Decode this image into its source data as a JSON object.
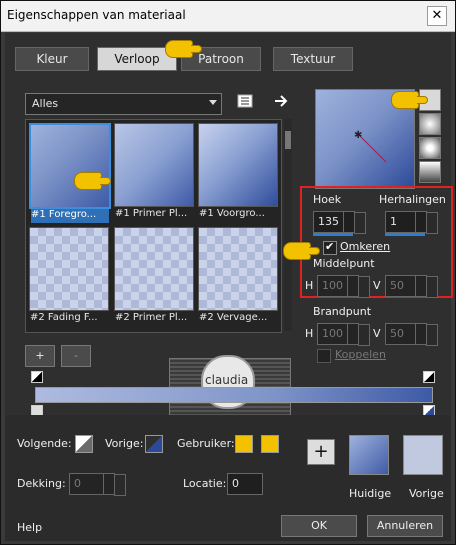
{
  "window": {
    "title": "Eigenschappen van materiaal",
    "close_glyph": "✕"
  },
  "tabs": [
    {
      "label": "Kleur",
      "active": false
    },
    {
      "label": "Verloop",
      "active": true
    },
    {
      "label": "Patroon",
      "active": false
    },
    {
      "label": "Textuur",
      "active": false
    }
  ],
  "category_select": {
    "value": "Alles"
  },
  "swatches": [
    {
      "label": "#1 Foregro...",
      "style": "g1",
      "selected": true
    },
    {
      "label": "#1 Primer Pl...",
      "style": "g2",
      "selected": false
    },
    {
      "label": "#1 Voorgro...",
      "style": "g3",
      "selected": false
    },
    {
      "label": "#2 Fading F...",
      "style": "chk",
      "selected": false
    },
    {
      "label": "#2 Primer Pl...",
      "style": "chk",
      "selected": false
    },
    {
      "label": "#2 Vervage...",
      "style": "chk",
      "selected": false
    }
  ],
  "gradient_controls": {
    "hoek_label": "Hoek",
    "hoek_value": "135",
    "herhalingen_label": "Herhalingen",
    "herhalingen_value": "1",
    "omkeren_label": "Omkeren",
    "omkeren_checked": true
  },
  "middelpunt": {
    "label": "Middelpunt",
    "h_label": "H",
    "h_value": "100",
    "v_label": "V",
    "v_value": "50"
  },
  "brandpunt": {
    "label": "Brandpunt",
    "h_label": "H",
    "h_value": "100",
    "v_label": "V",
    "v_value": "50",
    "koppelen_label": "Koppelen"
  },
  "stop_controls": {
    "add_label": "+",
    "remove_label": "-"
  },
  "footer": {
    "volgende_label": "Volgende:",
    "vorige_label": "Vorige:",
    "gebruiker_label": "Gebruiker:",
    "dekking_label": "Dekking:",
    "dekking_value": "0",
    "locatie_label": "Locatie:",
    "locatie_value": "0",
    "plus_label": "+",
    "huidige_label": "Huidige",
    "vorige_swatch_label": "Vorige",
    "help_label": "Help",
    "ok_label": "OK",
    "annuleren_label": "Annuleren"
  },
  "watermark": {
    "text": "claudia"
  },
  "colors": {
    "accent_blue": "#2e6fb5",
    "highlight_red": "#dd2222",
    "user_color": "#f2c200"
  }
}
